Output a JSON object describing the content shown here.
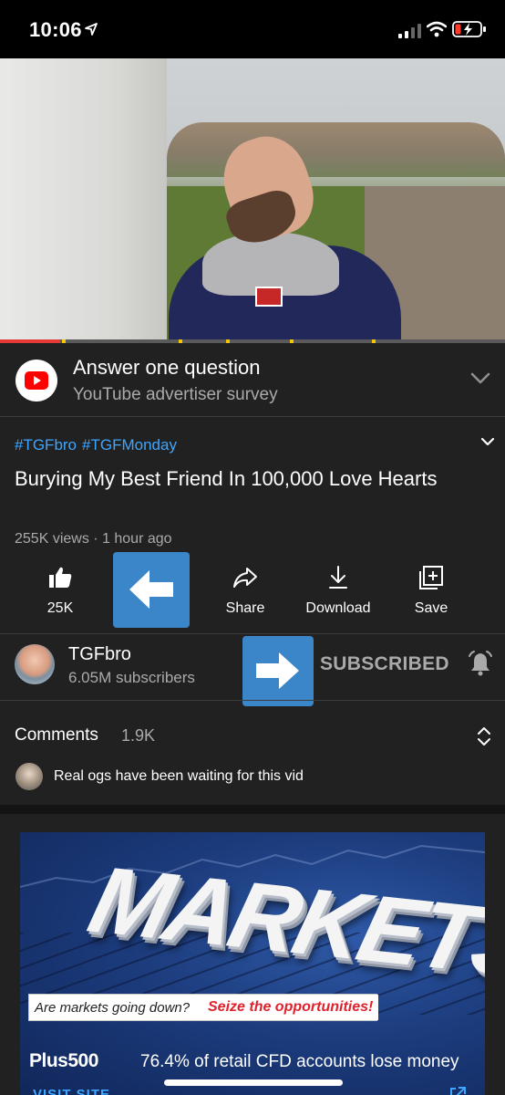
{
  "status_bar": {
    "time": "10:06"
  },
  "player": {
    "progress_fraction": 0.12
  },
  "ad_survey": {
    "title": "Answer one question",
    "subtitle": "YouTube advertiser survey"
  },
  "video": {
    "hashtags": [
      "#TGFbro",
      "#TGFMonday"
    ],
    "title": "Burying My Best Friend In 100,000 Love Hearts",
    "meta": "255K views · 1 hour ago"
  },
  "actions": {
    "like_count": "25K",
    "share_label": "Share",
    "download_label": "Download",
    "save_label": "Save"
  },
  "channel": {
    "name": "TGFbro",
    "subscribers": "6.05M subscribers",
    "subscribe_state": "SUBSCRIBED"
  },
  "comments": {
    "header": "Comments",
    "count": "1.9K",
    "top_comment": "Real ogs have been waiting for this vid"
  },
  "banner_ad": {
    "headline": "MARKETS",
    "tagline_question": "Are markets going down?",
    "tagline_cta": "Seize the opportunities!",
    "brand": "Plus500",
    "risk_warning": "76.4% of retail CFD accounts lose money",
    "visit_label": "VISIT SITE"
  },
  "colors": {
    "background": "#212121",
    "link_blue": "#3ea6ff",
    "overlay_blue": "#3a86c8",
    "progress_red": "#e53935",
    "ad_marker": "#f7c600"
  }
}
